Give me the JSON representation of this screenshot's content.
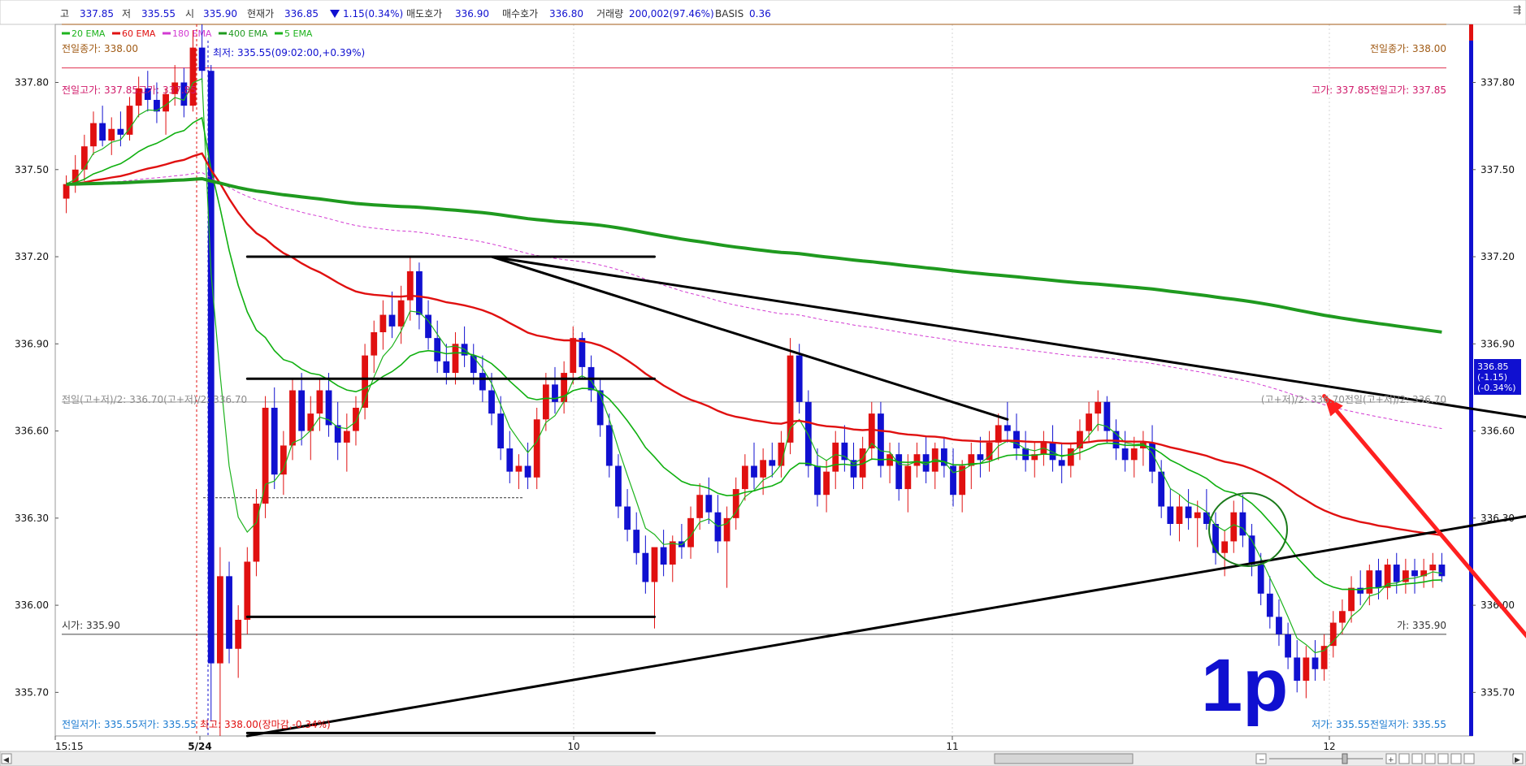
{
  "info": {
    "high_label": "고",
    "high": "337.85",
    "low_label": "저",
    "low": "335.55",
    "open_label": "시",
    "open": "335.90",
    "current_label": "현재가",
    "current": "336.85",
    "change": "1.15(0.34%)",
    "ask_label": "매도호가",
    "ask": "336.90",
    "bid_label": "매수호가",
    "bid": "336.80",
    "volume_label": "거래량",
    "volume": "200,002(97.46%)",
    "basis_label": "BASIS",
    "basis": "0.36"
  },
  "legend": [
    {
      "label": "20 EMA",
      "color": "#1db31d"
    },
    {
      "label": "60 EMA",
      "color": "#e01010"
    },
    {
      "label": "180 EMA",
      "color": "#d23ad2"
    },
    {
      "label": "400 EMA",
      "color": "#1f9a1f"
    },
    {
      "label": "5 EMA",
      "color": "#1db31d"
    }
  ],
  "ref_labels": {
    "prev_close_left": "전일종가: 338.00",
    "prev_close_right": "전일종가: 338.00",
    "intraday_low": "최저: 335.55(09:02:00,+0.39%)",
    "prev_high_left": "전일고가: 337.85고가: 337.85",
    "prev_high_right": "고가: 337.85전일고가: 337.85",
    "mid_left": "전일(고+저)/2: 336.70(고+저)/2: 336.70",
    "mid_right": "(고+저)/2: 336.70전일(고+저)/2: 336.70",
    "open_left": "시가: 335.90",
    "open_right": "가: 335.90",
    "low_left": "전일저가: 335.55저가: 335.55",
    "high_bottom": "최고: 338.00(장마감,-0.34%)",
    "low_right": "저가: 335.55전일저가: 335.55"
  },
  "price_badge": {
    "price": "336.85",
    "change": "(-1.15)",
    "pct": "(-0.34%)"
  },
  "annotation": "1p",
  "colors": {
    "up": "#e01010",
    "down": "#1010d0",
    "accent": "#1010d0"
  },
  "chart_data": {
    "type": "candlestick",
    "y_ticks": [
      "337.80",
      "337.50",
      "337.20",
      "336.90",
      "336.60",
      "336.30",
      "336.00",
      "335.70"
    ],
    "ylim": [
      335.55,
      338.0
    ],
    "x_ticks": [
      "15:15",
      "5/24",
      "10",
      "11",
      "12"
    ],
    "x_tick_bar_index": [
      0,
      0,
      0,
      0,
      0
    ],
    "bar_count": 200,
    "ema_periods": [
      5,
      20,
      60,
      180,
      400
    ],
    "reference_lines": {
      "prev_close": 338.0,
      "prev_high": 337.85,
      "mid": 336.7,
      "open": 335.9,
      "low": 335.55
    },
    "bars": [
      [
        337.4,
        337.48,
        337.35,
        337.45
      ],
      [
        337.45,
        337.55,
        337.42,
        337.5
      ],
      [
        337.5,
        337.62,
        337.46,
        337.58
      ],
      [
        337.58,
        337.7,
        337.55,
        337.66
      ],
      [
        337.66,
        337.72,
        337.58,
        337.6
      ],
      [
        337.6,
        337.68,
        337.55,
        337.64
      ],
      [
        337.64,
        337.7,
        337.58,
        337.62
      ],
      [
        337.62,
        337.75,
        337.6,
        337.72
      ],
      [
        337.72,
        337.82,
        337.68,
        337.78
      ],
      [
        337.78,
        337.84,
        337.7,
        337.74
      ],
      [
        337.74,
        337.8,
        337.66,
        337.7
      ],
      [
        337.7,
        337.78,
        337.62,
        337.76
      ],
      [
        337.76,
        337.86,
        337.72,
        337.8
      ],
      [
        337.8,
        337.85,
        337.68,
        337.72
      ],
      [
        337.72,
        337.98,
        337.7,
        337.92
      ],
      [
        337.92,
        338.0,
        337.8,
        337.84
      ],
      [
        337.84,
        337.86,
        335.6,
        335.8
      ],
      [
        335.8,
        336.2,
        335.55,
        336.1
      ],
      [
        336.1,
        336.15,
        335.8,
        335.85
      ],
      [
        335.85,
        336.0,
        335.75,
        335.95
      ],
      [
        335.95,
        336.2,
        335.9,
        336.15
      ],
      [
        336.15,
        336.4,
        336.1,
        336.35
      ],
      [
        336.35,
        336.72,
        336.3,
        336.68
      ],
      [
        336.68,
        336.75,
        336.4,
        336.45
      ],
      [
        336.45,
        336.6,
        336.38,
        336.55
      ],
      [
        336.55,
        336.78,
        336.5,
        336.74
      ],
      [
        336.74,
        336.8,
        336.55,
        336.6
      ],
      [
        336.6,
        336.72,
        336.5,
        336.66
      ],
      [
        336.66,
        336.78,
        336.6,
        336.74
      ],
      [
        336.74,
        336.8,
        336.58,
        336.62
      ],
      [
        336.62,
        336.7,
        336.5,
        336.56
      ],
      [
        336.56,
        336.66,
        336.46,
        336.6
      ],
      [
        336.6,
        336.72,
        336.55,
        336.68
      ],
      [
        336.68,
        336.9,
        336.64,
        336.86
      ],
      [
        336.86,
        336.98,
        336.8,
        336.94
      ],
      [
        336.94,
        337.05,
        336.88,
        337.0
      ],
      [
        337.0,
        337.08,
        336.92,
        336.96
      ],
      [
        336.96,
        337.1,
        336.9,
        337.05
      ],
      [
        337.05,
        337.2,
        336.98,
        337.15
      ],
      [
        337.15,
        337.18,
        336.95,
        337.0
      ],
      [
        337.0,
        337.05,
        336.88,
        336.92
      ],
      [
        336.92,
        336.98,
        336.8,
        336.84
      ],
      [
        336.84,
        336.9,
        336.76,
        336.8
      ],
      [
        336.8,
        336.94,
        336.76,
        336.9
      ],
      [
        336.9,
        336.96,
        336.82,
        336.86
      ],
      [
        336.86,
        336.9,
        336.76,
        336.8
      ],
      [
        336.8,
        336.86,
        336.7,
        336.74
      ],
      [
        336.74,
        336.8,
        336.62,
        336.66
      ],
      [
        336.66,
        336.72,
        336.5,
        336.54
      ],
      [
        336.54,
        336.6,
        336.42,
        336.46
      ],
      [
        336.46,
        336.52,
        336.4,
        336.48
      ],
      [
        336.48,
        336.56,
        336.4,
        336.44
      ],
      [
        336.44,
        336.68,
        336.4,
        336.64
      ],
      [
        336.64,
        336.8,
        336.6,
        336.76
      ],
      [
        336.76,
        336.82,
        336.66,
        336.7
      ],
      [
        336.7,
        336.84,
        336.66,
        336.8
      ],
      [
        336.8,
        336.96,
        336.76,
        336.92
      ],
      [
        336.92,
        336.94,
        336.78,
        336.82
      ],
      [
        336.82,
        336.86,
        336.7,
        336.74
      ],
      [
        336.74,
        336.78,
        336.58,
        336.62
      ],
      [
        336.62,
        336.66,
        336.44,
        336.48
      ],
      [
        336.48,
        336.52,
        336.3,
        336.34
      ],
      [
        336.34,
        336.4,
        336.22,
        336.26
      ],
      [
        336.26,
        336.32,
        336.14,
        336.18
      ],
      [
        336.18,
        336.24,
        336.04,
        336.08
      ],
      [
        336.08,
        336.14,
        335.92,
        336.2
      ],
      [
        336.2,
        336.26,
        336.1,
        336.14
      ],
      [
        336.14,
        336.24,
        336.08,
        336.22
      ],
      [
        336.22,
        336.28,
        336.16,
        336.2
      ],
      [
        336.2,
        336.34,
        336.16,
        336.3
      ],
      [
        336.3,
        336.42,
        336.26,
        336.38
      ],
      [
        336.38,
        336.44,
        336.28,
        336.32
      ],
      [
        336.32,
        336.38,
        336.18,
        336.22
      ],
      [
        336.22,
        336.34,
        336.06,
        336.3
      ],
      [
        336.3,
        336.44,
        336.26,
        336.4
      ],
      [
        336.4,
        336.52,
        336.36,
        336.48
      ],
      [
        336.48,
        336.56,
        336.4,
        336.44
      ],
      [
        336.44,
        336.54,
        336.38,
        336.5
      ],
      [
        336.5,
        336.56,
        336.44,
        336.48
      ],
      [
        336.48,
        336.6,
        336.44,
        336.56
      ],
      [
        336.56,
        336.92,
        336.52,
        336.86
      ],
      [
        336.86,
        336.9,
        336.66,
        336.7
      ],
      [
        336.7,
        336.74,
        336.44,
        336.48
      ],
      [
        336.48,
        336.54,
        336.34,
        336.38
      ],
      [
        336.38,
        336.5,
        336.32,
        336.46
      ],
      [
        336.46,
        336.6,
        336.4,
        336.56
      ],
      [
        336.56,
        336.62,
        336.46,
        336.5
      ],
      [
        336.5,
        336.56,
        336.4,
        336.44
      ],
      [
        336.44,
        336.58,
        336.4,
        336.54
      ],
      [
        336.54,
        336.7,
        336.5,
        336.66
      ],
      [
        336.66,
        336.7,
        336.44,
        336.48
      ],
      [
        336.48,
        336.56,
        336.42,
        336.52
      ],
      [
        336.52,
        336.56,
        336.36,
        336.4
      ],
      [
        336.4,
        336.52,
        336.32,
        336.48
      ],
      [
        336.48,
        336.56,
        336.44,
        336.52
      ],
      [
        336.52,
        336.58,
        336.42,
        336.46
      ],
      [
        336.46,
        336.56,
        336.4,
        336.54
      ],
      [
        336.54,
        336.58,
        336.44,
        336.48
      ],
      [
        336.48,
        336.54,
        336.34,
        336.38
      ],
      [
        336.38,
        336.5,
        336.32,
        336.48
      ],
      [
        336.48,
        336.56,
        336.4,
        336.52
      ],
      [
        336.52,
        336.58,
        336.44,
        336.5
      ],
      [
        336.5,
        336.6,
        336.46,
        336.56
      ],
      [
        336.56,
        336.66,
        336.5,
        336.62
      ],
      [
        336.62,
        336.7,
        336.56,
        336.6
      ],
      [
        336.6,
        336.66,
        336.5,
        336.54
      ],
      [
        336.54,
        336.6,
        336.46,
        336.5
      ],
      [
        336.5,
        336.56,
        336.44,
        336.52
      ],
      [
        336.52,
        336.6,
        336.48,
        336.56
      ],
      [
        336.56,
        336.62,
        336.46,
        336.5
      ],
      [
        336.5,
        336.56,
        336.42,
        336.48
      ],
      [
        336.48,
        336.56,
        336.44,
        336.54
      ],
      [
        336.54,
        336.64,
        336.5,
        336.6
      ],
      [
        336.6,
        336.7,
        336.56,
        336.66
      ],
      [
        336.66,
        336.74,
        336.6,
        336.7
      ],
      [
        336.7,
        336.72,
        336.56,
        336.6
      ],
      [
        336.6,
        336.64,
        336.5,
        336.54
      ],
      [
        336.54,
        336.6,
        336.46,
        336.5
      ],
      [
        336.5,
        336.58,
        336.44,
        336.54
      ],
      [
        336.54,
        336.6,
        336.48,
        336.56
      ],
      [
        336.56,
        336.62,
        336.42,
        336.46
      ],
      [
        336.46,
        336.5,
        336.3,
        336.34
      ],
      [
        336.34,
        336.4,
        336.24,
        336.28
      ],
      [
        336.28,
        336.38,
        336.22,
        336.34
      ],
      [
        336.34,
        336.4,
        336.26,
        336.3
      ],
      [
        336.3,
        336.36,
        336.2,
        336.32
      ],
      [
        336.32,
        336.4,
        336.26,
        336.28
      ],
      [
        336.28,
        336.32,
        336.14,
        336.18
      ],
      [
        336.18,
        336.26,
        336.1,
        336.22
      ],
      [
        336.22,
        336.36,
        336.18,
        336.32
      ],
      [
        336.32,
        336.38,
        336.2,
        336.24
      ],
      [
        336.24,
        336.28,
        336.1,
        336.14
      ],
      [
        336.14,
        336.18,
        336.0,
        336.04
      ],
      [
        336.04,
        336.1,
        335.92,
        335.96
      ],
      [
        335.96,
        336.02,
        335.86,
        335.9
      ],
      [
        335.9,
        335.94,
        335.78,
        335.82
      ],
      [
        335.82,
        335.88,
        335.7,
        335.74
      ],
      [
        335.74,
        335.86,
        335.68,
        335.82
      ],
      [
        335.82,
        335.88,
        335.74,
        335.78
      ],
      [
        335.78,
        335.9,
        335.74,
        335.86
      ],
      [
        335.86,
        335.98,
        335.82,
        335.94
      ],
      [
        335.94,
        336.02,
        335.9,
        335.98
      ],
      [
        335.98,
        336.1,
        335.94,
        336.06
      ],
      [
        336.06,
        336.12,
        336.0,
        336.04
      ],
      [
        336.04,
        336.14,
        336.0,
        336.12
      ],
      [
        336.12,
        336.16,
        336.02,
        336.06
      ],
      [
        336.06,
        336.16,
        336.02,
        336.14
      ],
      [
        336.14,
        336.18,
        336.04,
        336.08
      ],
      [
        336.08,
        336.16,
        336.04,
        336.12
      ],
      [
        336.12,
        336.16,
        336.04,
        336.1
      ],
      [
        336.1,
        336.16,
        336.06,
        336.12
      ],
      [
        336.12,
        336.18,
        336.06,
        336.14
      ],
      [
        336.14,
        336.18,
        336.08,
        336.1
      ]
    ],
    "trendlines": [
      {
        "from": [
          20,
          337.2
        ],
        "to": [
          65,
          337.2
        ],
        "color": "#000000"
      },
      {
        "from": [
          20,
          336.78
        ],
        "to": [
          65,
          336.78
        ],
        "color": "#000000"
      },
      {
        "from": [
          20,
          335.96
        ],
        "to": [
          65,
          335.96
        ],
        "color": "#000000"
      },
      {
        "from": [
          20,
          335.56
        ],
        "to": [
          65,
          335.56
        ],
        "color": "#000000"
      },
      {
        "from": [
          47,
          337.2
        ],
        "to": [
          104,
          336.64
        ],
        "color": "#000000"
      },
      {
        "from": [
          47,
          337.2
        ],
        "to": [
          167,
          336.62
        ],
        "color": "#000000"
      },
      {
        "from": [
          20,
          335.55
        ],
        "to": [
          190,
          336.46
        ],
        "color": "#000000"
      },
      {
        "from": [
          139,
          336.72
        ],
        "to": [
          165,
          335.76
        ],
        "color": "#ff2020"
      }
    ]
  }
}
